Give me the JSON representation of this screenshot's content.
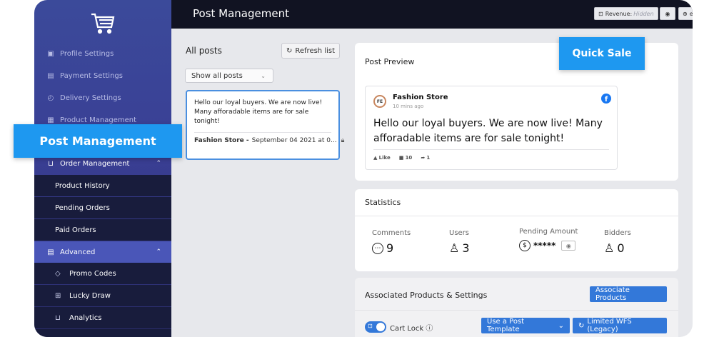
{
  "sidebar": {
    "items": [
      {
        "icon": "profile-icon",
        "glyph": "▣",
        "label": "Profile Settings"
      },
      {
        "icon": "payment-icon",
        "glyph": "▤",
        "label": "Payment Settings"
      },
      {
        "icon": "delivery-icon",
        "glyph": "◴",
        "label": "Delivery Settings"
      },
      {
        "icon": "product-icon",
        "glyph": "▦",
        "label": "Product Management"
      }
    ],
    "order_management": {
      "label": "Order Management",
      "icon": "cart-icon"
    },
    "order_sub": [
      "Product History",
      "Pending Orders",
      "Paid Orders"
    ],
    "advanced": {
      "label": "Advanced",
      "icon": "advanced-icon"
    },
    "advanced_sub": [
      {
        "icon": "promo-icon",
        "glyph": "◇",
        "label": "Promo Codes"
      },
      {
        "icon": "gift-icon",
        "glyph": "⊞",
        "label": "Lucky Draw"
      },
      {
        "icon": "analytics-icon",
        "glyph": "⊔",
        "label": "Analytics"
      }
    ]
  },
  "topbar": {
    "title": "Post Management",
    "revenue_label": "Revenue:",
    "revenue_value": "Hidden",
    "lang": "en"
  },
  "posts": {
    "heading": "All posts",
    "refresh_label": "Refresh list",
    "filter_value": "Show all posts",
    "selected_post": {
      "text": "Hello our loyal buyers. We are now live! Many afforadable items are for sale tonight!",
      "store": "Fashion Store -",
      "date": "September 04 2021 at 0..."
    }
  },
  "preview": {
    "title": "Post Preview",
    "store_name": "Fashion Store",
    "avatar_text": "FE",
    "time": "10 mins ago",
    "message": "Hello our loyal buyers. We are now live! Many afforadable items are for sale tonight!",
    "like_label": "Like",
    "comments": "10",
    "shares": "1"
  },
  "callouts": {
    "quick_sale": "Quick Sale",
    "post_management": "Post Management"
  },
  "stats": {
    "title": "Statistics",
    "comments_label": "Comments",
    "comments_value": "9",
    "users_label": "Users",
    "users_value": "3",
    "pending_label": "Pending Amount",
    "pending_value": "*****",
    "bidders_label": "Bidders",
    "bidders_value": "0"
  },
  "associated": {
    "title": "Associated Products & Settings",
    "associate_label": "Associate Products",
    "cart_lock_label": "Cart Lock",
    "template_label": "Use a Post Template",
    "wfs_label": "Limited WFS (Legacy)"
  },
  "colors": {
    "accent": "#1e98f0",
    "primary_button": "#3378d9",
    "sidebar_top": "#3b4a9a",
    "topbar": "#111322"
  }
}
